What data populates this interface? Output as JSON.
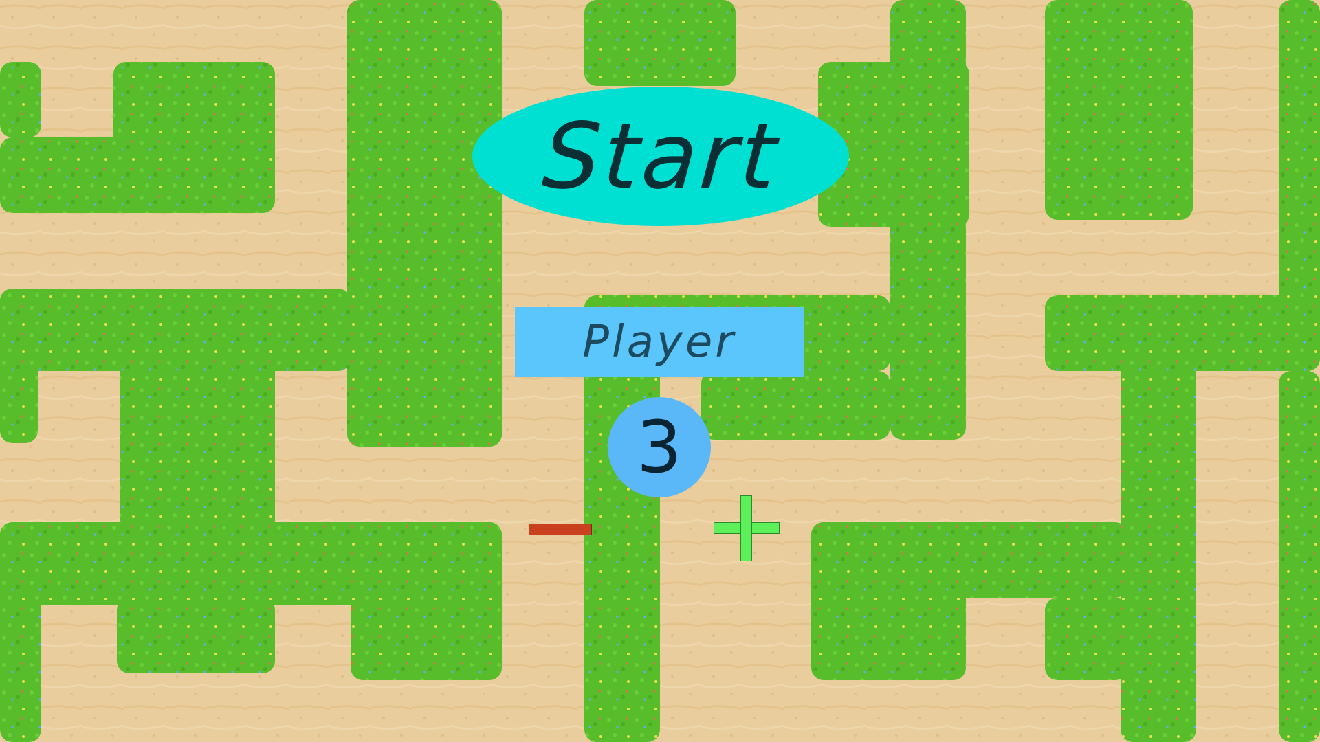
{
  "menu": {
    "start_label": "Start",
    "player_label": "Player",
    "player_count": "3"
  },
  "controls": {
    "decrease_icon": "minus-icon",
    "increase_icon": "plus-icon"
  },
  "colors": {
    "grass": "#5bbf2e",
    "sand": "#e6c894",
    "start_button": "#00e0d2",
    "player_label_bg": "#5ac6fb",
    "player_count_bg": "#5ab8f8",
    "minus": "#c8401e",
    "plus": "#5ef05a"
  }
}
